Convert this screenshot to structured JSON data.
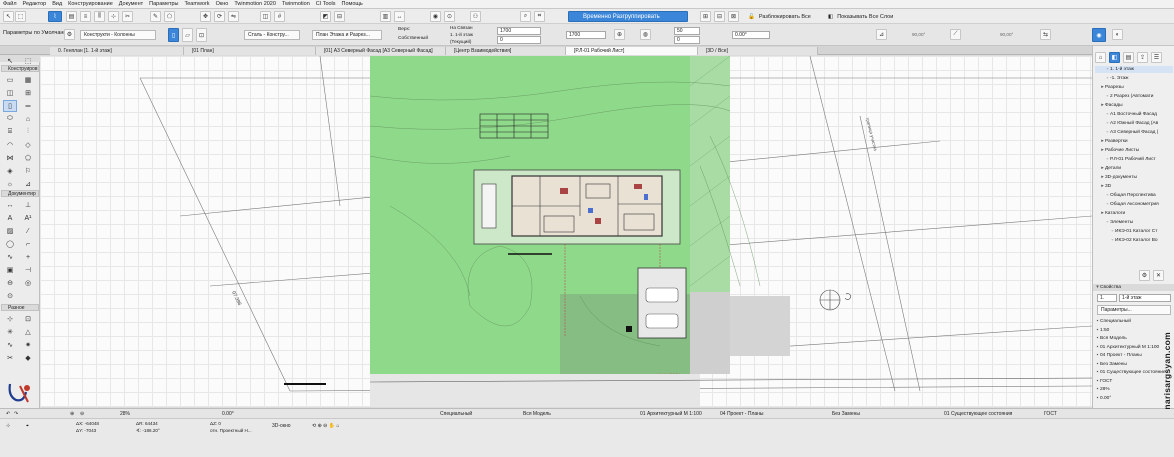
{
  "menu": [
    "Файл",
    "Редактор",
    "Вид",
    "Конструирование",
    "Документ",
    "Параметры",
    "Teamwork",
    "Окно",
    "Twinmotion 2020",
    "Twinmotion",
    "CI Tools",
    "Помощь"
  ],
  "toolbar1": {
    "ungroup_label": "Временно Разгруппировать",
    "unlock_all_label": "Разблокировать Все",
    "show_all_layers_label": "Показывать Все Слои"
  },
  "toolbar2": {
    "defaults_label": "Параметры по Умолчанию",
    "construct_select": "Конструкти - Колонны",
    "style_select": "Сталь - Констру...",
    "plan_select": "План Этажа и Разрез...",
    "top_label": "Верх:",
    "top_value": "Собственный",
    "link_label": "На Связан",
    "floor_value": "1. 1-й этаж",
    "home_label": "(Текущий)",
    "height_value": "1700",
    "offset_value": "0",
    "width_value": "1700",
    "top_small_value": "50",
    "angle_value": "0.00°",
    "zero_value": "0",
    "angle2_value": "90,00°",
    "angle3_value": "90,00°"
  },
  "tabs": [
    "0. Генплан [1. 1-й этаж]",
    "[01 План]",
    "[01] А3 Северный Фасад [А3 Северный Фасад]",
    "[Центр Взаимодействия]",
    "[Р.Л-01 Рабочий Лист]",
    "[3D / Все]"
  ],
  "toolbox": {
    "sections": [
      "Конструиров",
      "Документир",
      "Разное"
    ]
  },
  "rightpane": {
    "tree": [
      {
        "label": "1. 1-й этаж",
        "level": 2,
        "selected": true
      },
      {
        "label": "-1. Этаж",
        "level": 2
      },
      {
        "label": "Разрезы",
        "level": 1
      },
      {
        "label": "2 Разрез (Автомати",
        "level": 2
      },
      {
        "label": "Фасады",
        "level": 1
      },
      {
        "label": "А1 Восточный Фасад",
        "level": 2
      },
      {
        "label": "А2 Южный Фасад (Ав",
        "level": 2
      },
      {
        "label": "А3 Северный Фасад (",
        "level": 2
      },
      {
        "label": "Развертки",
        "level": 1
      },
      {
        "label": "Рабочие Листы",
        "level": 1
      },
      {
        "label": "Р.Л-01 Рабочий Лист",
        "level": 2
      },
      {
        "label": "Детали",
        "level": 1
      },
      {
        "label": "3D-документы",
        "level": 1
      },
      {
        "label": "3D",
        "level": 1
      },
      {
        "label": "Общая Перспектива",
        "level": 2
      },
      {
        "label": "Общая Аксонометрия",
        "level": 2
      },
      {
        "label": "Каталоги",
        "level": 1
      },
      {
        "label": "Элементы",
        "level": 2
      },
      {
        "label": "ИКЭ-01 Каталог Ст",
        "level": 3
      },
      {
        "label": "ИКЭ-02 Каталог Во",
        "level": 3
      }
    ],
    "properties_title": "Свойства",
    "prop_floor_num": "1.",
    "prop_floor_name": "1-й этаж",
    "params_button": "Параметры...",
    "props": [
      "Специальный",
      "1:50",
      "Вся Модель",
      "01 Архитектурный М 1:100",
      "04 Проект - Планы",
      "Без Замены",
      "01 Существующее состояние",
      "ГОСТ",
      "28%",
      "0.00°"
    ]
  },
  "statusbar": {
    "zoom": "28%",
    "angle": "0.00°",
    "dx_label": "ΔX: -64048",
    "dy_label": "ΔY: -7043",
    "dr_label": "ΔR: 64434",
    "da_label": "∢: -186.20°",
    "dz_label": "ΔZ: 0",
    "ref_label": "отн. Проектный Н...",
    "window_3d": "3D-окно"
  },
  "bottombar": {
    "special": "Специальный",
    "model": "Вся Модель",
    "arch": "01 Архитектурный М 1:100",
    "project_plans": "04 Проект - Планы",
    "no_replace": "Без Замены",
    "existing": "01 Существующее состояния",
    "gost": "ГОСТ"
  },
  "canvas": {
    "dimension_text": "07.396",
    "property_line_label": "граница участка"
  },
  "watermark": "narisargsyan.com",
  "colors": {
    "site_green": "#8fd98a",
    "house_wall": "#555555",
    "accent_blue": "#3b86d8"
  }
}
